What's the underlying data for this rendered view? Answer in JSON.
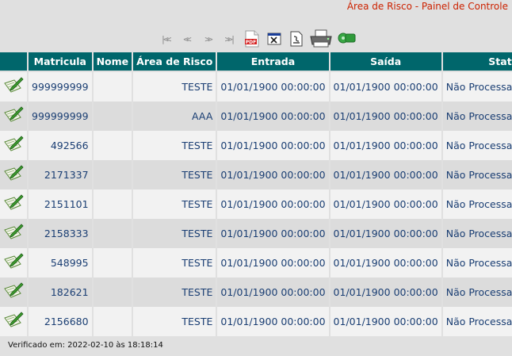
{
  "header": {
    "title": "Área de Risco - Painel de Controle"
  },
  "toolbar": {
    "nav": [
      {
        "label": "|<<",
        "icon": "first-page-icon"
      },
      {
        "label": "<<",
        "icon": "previous-page-icon"
      },
      {
        "label": ">>",
        "icon": "next-page-icon"
      },
      {
        "label": ">>|",
        "icon": "last-page-icon"
      }
    ],
    "tools": [
      "pdf-export-icon",
      "excel-export-icon",
      "text-export-icon",
      "printer-icon",
      "settings-icon"
    ],
    "pdf_label": "PDF"
  },
  "table": {
    "columns": [
      "Matricula",
      "Nome",
      "Área de Risco",
      "Entrada",
      "Saída",
      "Status"
    ],
    "rows": [
      {
        "matricula": "999999999",
        "nome": "",
        "area": "TESTE",
        "entrada": "01/01/1900 00:00:00",
        "saida": "01/01/1900 00:00:00",
        "status": "Não Processado"
      },
      {
        "matricula": "999999999",
        "nome": "",
        "area": "AAA",
        "entrada": "01/01/1900 00:00:00",
        "saida": "01/01/1900 00:00:00",
        "status": "Não Processado"
      },
      {
        "matricula": "492566",
        "nome": "",
        "area": "TESTE",
        "entrada": "01/01/1900 00:00:00",
        "saida": "01/01/1900 00:00:00",
        "status": "Não Processado"
      },
      {
        "matricula": "2171337",
        "nome": "",
        "area": "TESTE",
        "entrada": "01/01/1900 00:00:00",
        "saida": "01/01/1900 00:00:00",
        "status": "Não Processado"
      },
      {
        "matricula": "2151101",
        "nome": "",
        "area": "TESTE",
        "entrada": "01/01/1900 00:00:00",
        "saida": "01/01/1900 00:00:00",
        "status": "Não Processado"
      },
      {
        "matricula": "2158333",
        "nome": "",
        "area": "TESTE",
        "entrada": "01/01/1900 00:00:00",
        "saida": "01/01/1900 00:00:00",
        "status": "Não Processado"
      },
      {
        "matricula": "548995",
        "nome": "",
        "area": "TESTE",
        "entrada": "01/01/1900 00:00:00",
        "saida": "01/01/1900 00:00:00",
        "status": "Não Processado"
      },
      {
        "matricula": "182621",
        "nome": "",
        "area": "TESTE",
        "entrada": "01/01/1900 00:00:00",
        "saida": "01/01/1900 00:00:00",
        "status": "Não Processado"
      },
      {
        "matricula": "2156680",
        "nome": "",
        "area": "TESTE",
        "entrada": "01/01/1900 00:00:00",
        "saida": "01/01/1900 00:00:00",
        "status": "Não Processado"
      }
    ]
  },
  "footer": {
    "verified": "Verificado em: 2022-02-10 às 18:18:14"
  },
  "colors": {
    "header_bg": "#00666b",
    "title": "#cc2200",
    "cell_text": "#1a3e73"
  }
}
